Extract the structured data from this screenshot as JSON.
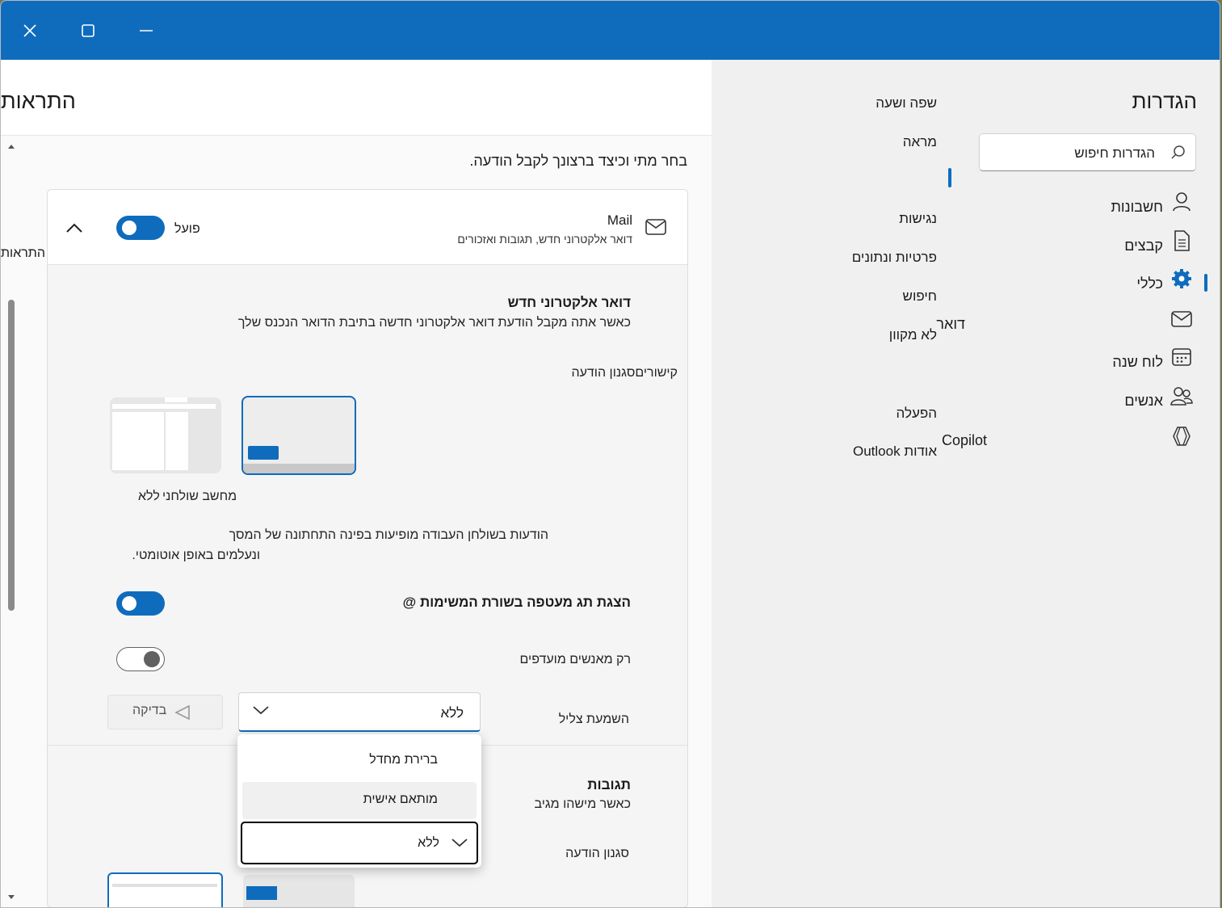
{
  "window": {
    "controls": {
      "close": "close",
      "maximize": "maximize",
      "minimize": "minimize"
    }
  },
  "nav": {
    "title": "הגדרות",
    "search_placeholder": "הגדרות חיפוש",
    "items": [
      {
        "label": "חשבונות",
        "icon": "person-icon"
      },
      {
        "label": "קבצים",
        "icon": "document-icon"
      },
      {
        "label": "כללי",
        "icon": "gear-icon",
        "active": true
      },
      {
        "label": "דואר",
        "icon": "mail-icon"
      },
      {
        "label": "לוח שנה",
        "icon": "calendar-icon"
      },
      {
        "label": "אנשים",
        "icon": "people-icon"
      },
      {
        "label": "Copilot",
        "icon": "copilot-icon"
      }
    ]
  },
  "subnav": {
    "items": [
      "שפה ושעה",
      "מראה",
      "נגישות",
      "פרטיות ונתונים",
      "חיפוש",
      "לא מקוון",
      "הפעלה",
      "אודות Outlook"
    ]
  },
  "page": {
    "title": "התראות",
    "intro": "בחר מתי וכיצד ברצונך לקבל הודעה.",
    "breadcrumb": "התראות"
  },
  "mail_card": {
    "name": "Mail",
    "description": "דואר אלקטרוני חדש, תגובות ואזכורים",
    "toggle_label": "פועל",
    "toggle_on": true,
    "new_mail": {
      "title": "דואר אלקטרוני חדש",
      "description": "כאשר אתה מקבל הודעת דואר אלקטרוני חדשה בתיבת הדואר הנכנס שלך",
      "style_label": "קישוריםסגנון הודעה",
      "option_desktop": "מחשב שולחני",
      "option_none": "ללא",
      "desktop_desc_1": "הודעות בשולחן העבודה מופיעות בפינה התחתונה של המסך",
      "desktop_desc_2": "ונעלמים באופן אוטומטי."
    },
    "taskbar_badge": {
      "label": "הצגת תג מעטפה בשורת המשימות @",
      "on": true
    },
    "vip_only": {
      "label": "רק מאנשים מועדפים",
      "on": false
    },
    "sound": {
      "label": "השמעת צליל",
      "value": "ללא",
      "test_label": "בדיקה"
    },
    "reactions": {
      "title": "תגובות",
      "description": "כאשר מישהו מגיב",
      "style_label": "סגנון הודעה"
    }
  },
  "sound_dropdown": {
    "options": [
      "ברירת מחדל",
      "מותאם אישית",
      "ללא"
    ],
    "selected": "ללא"
  },
  "colors": {
    "accent": "#0f6cbd",
    "titlebar": "#0f6cbd",
    "nav_bg": "#f0f0f0"
  }
}
